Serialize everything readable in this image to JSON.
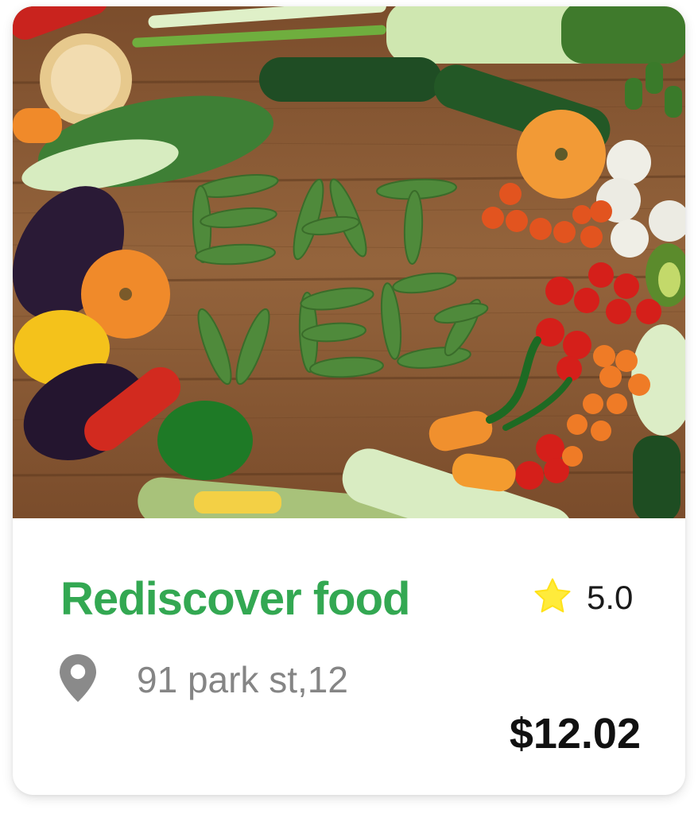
{
  "card": {
    "title": "Rediscover food",
    "rating": "5.0",
    "address": "91 park st,12",
    "price": "$12.02",
    "icons": {
      "rating": "star-icon",
      "location": "location-pin-icon"
    },
    "colors": {
      "title": "#33a852",
      "star": "#ffeb3b",
      "pin": "#8a8a8a"
    }
  }
}
